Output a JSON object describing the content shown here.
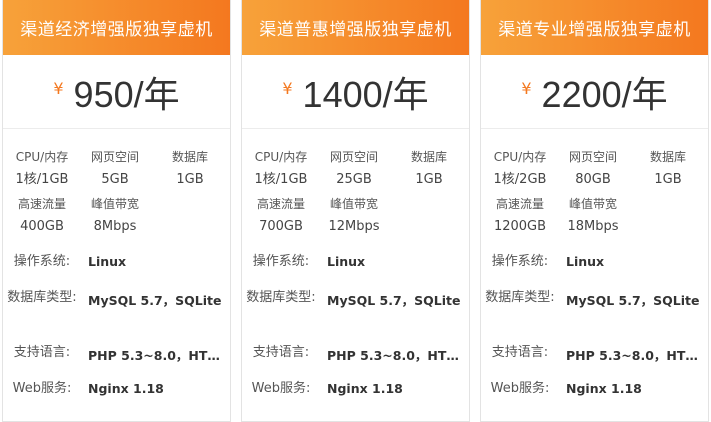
{
  "plans": [
    {
      "title": "渠道经济增强版独享虚机",
      "currency": "¥",
      "price": "950/年",
      "specs": {
        "cpu_label": "CPU/内存",
        "cpu_value": "1核/1GB",
        "web_label": "网页空间",
        "web_value": "5GB",
        "db_label": "数据库",
        "db_value": "1GB",
        "flow_label": "高速流量",
        "flow_value": "400GB",
        "bw_label": "峰值带宽",
        "bw_value": "8Mbps"
      },
      "os_label": "操作系统:",
      "os_value": "Linux",
      "dbtype_label": "数据库类型:",
      "dbtype_value": "MySQL 5.7，SQLite",
      "lang_label": "支持语言:",
      "lang_value": "PHP 5.3~8.0，HTM…",
      "websvc_label": "Web服务:",
      "websvc_value": "Nginx 1.18"
    },
    {
      "title": "渠道普惠增强版独享虚机",
      "currency": "¥",
      "price": "1400/年",
      "specs": {
        "cpu_label": "CPU/内存",
        "cpu_value": "1核/1GB",
        "web_label": "网页空间",
        "web_value": "25GB",
        "db_label": "数据库",
        "db_value": "1GB",
        "flow_label": "高速流量",
        "flow_value": "700GB",
        "bw_label": "峰值带宽",
        "bw_value": "12Mbps"
      },
      "os_label": "操作系统:",
      "os_value": "Linux",
      "dbtype_label": "数据库类型:",
      "dbtype_value": "MySQL 5.7，SQLite",
      "lang_label": "支持语言:",
      "lang_value": "PHP 5.3~8.0，HTM…",
      "websvc_label": "Web服务:",
      "websvc_value": "Nginx 1.18"
    },
    {
      "title": "渠道专业增强版独享虚机",
      "currency": "¥",
      "price": "2200/年",
      "specs": {
        "cpu_label": "CPU/内存",
        "cpu_value": "1核/2GB",
        "web_label": "网页空间",
        "web_value": "80GB",
        "db_label": "数据库",
        "db_value": "1GB",
        "flow_label": "高速流量",
        "flow_value": "1200GB",
        "bw_label": "峰值带宽",
        "bw_value": "18Mbps"
      },
      "os_label": "操作系统:",
      "os_value": "Linux",
      "dbtype_label": "数据库类型:",
      "dbtype_value": "MySQL 5.7，SQLite",
      "lang_label": "支持语言:",
      "lang_value": "PHP 5.3~8.0，HTM…",
      "websvc_label": "Web服务:",
      "websvc_value": "Nginx 1.18"
    }
  ],
  "colors": {
    "header_start": "#f7a23a",
    "header_end": "#f4781f",
    "currency": "#f4781f"
  }
}
